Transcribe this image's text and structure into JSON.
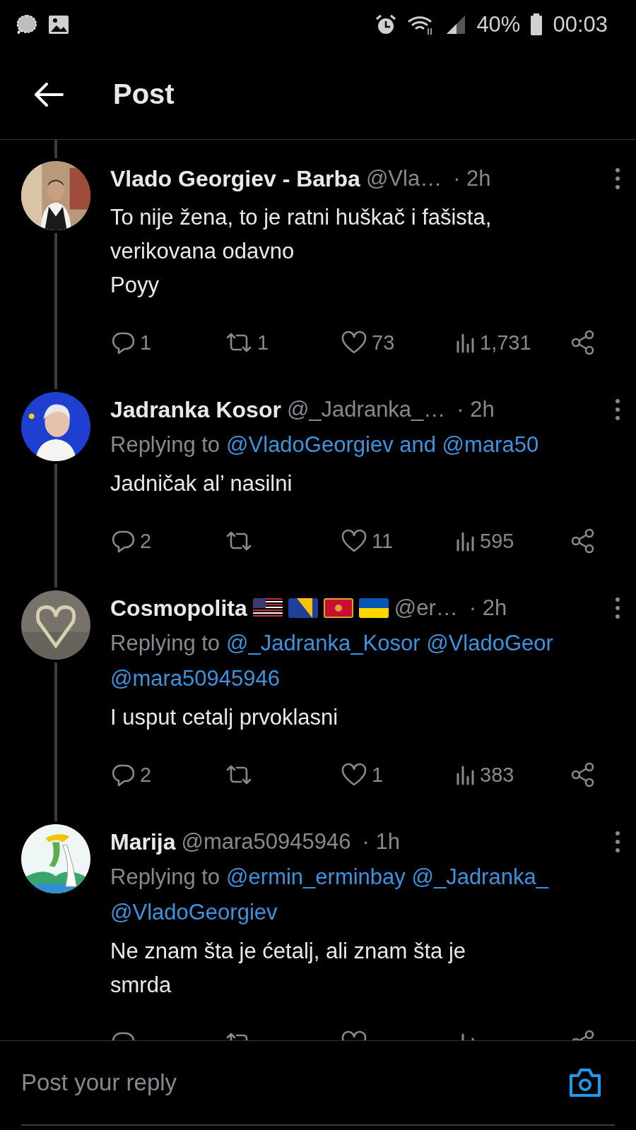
{
  "status_bar": {
    "battery": "40%",
    "time": "00:03"
  },
  "header": {
    "title": "Post"
  },
  "posts": [
    {
      "name": "Vlado Georgiev - Barba",
      "handle": "@Vla…",
      "time": "· 2h",
      "text": "To nije žena, to je ratni huškač i fašista,\nverikovana odavno\nPoyy",
      "actions": [
        {
          "kind": "reply",
          "count": "1"
        },
        {
          "kind": "repost",
          "count": "1"
        },
        {
          "kind": "like",
          "count": "73"
        },
        {
          "kind": "views",
          "count": "1,731"
        },
        {
          "kind": "share"
        }
      ]
    },
    {
      "name": "Jadranka Kosor",
      "handle": "@_Jadranka_…",
      "time": "· 2h",
      "replying": {
        "label": "Replying to",
        "lines": [
          "@VladoGeorgiev and @mara50"
        ]
      },
      "text": "Jadničak al’ nasilni",
      "actions": [
        {
          "kind": "reply",
          "count": "2"
        },
        {
          "kind": "repost"
        },
        {
          "kind": "like",
          "count": "11"
        },
        {
          "kind": "views",
          "count": "595"
        },
        {
          "kind": "share"
        }
      ]
    },
    {
      "name": "Cosmopolita",
      "flags": [
        {
          "kind": "us"
        },
        {
          "kind": "ba"
        },
        {
          "kind": "me"
        },
        {
          "kind": "ua"
        }
      ],
      "handle": "@er…",
      "time": "· 2h",
      "replying": {
        "label": "Replying to",
        "lines": [
          "@_Jadranka_Kosor @VladoGeor",
          "@mara50945946"
        ]
      },
      "text": "I usput cetalj prvoklasni",
      "actions": [
        {
          "kind": "reply",
          "count": "2"
        },
        {
          "kind": "repost"
        },
        {
          "kind": "like",
          "count": "1"
        },
        {
          "kind": "views",
          "count": "383"
        },
        {
          "kind": "share"
        }
      ]
    },
    {
      "name": "Marija",
      "handle": "@mara50945946",
      "time": "· 1h",
      "replying": {
        "label": "Replying to",
        "lines": [
          "@ermin_erminbay @_Jadranka_",
          "@VladoGeorgiev"
        ]
      },
      "text": "Ne znam šta je ćetalj, ali znam šta je\nsmrda",
      "actions": [
        {
          "kind": "reply"
        },
        {
          "kind": "repost"
        },
        {
          "kind": "like"
        },
        {
          "kind": "views"
        },
        {
          "kind": "share"
        }
      ]
    }
  ],
  "reply_bar": {
    "placeholder": "Post your reply"
  }
}
